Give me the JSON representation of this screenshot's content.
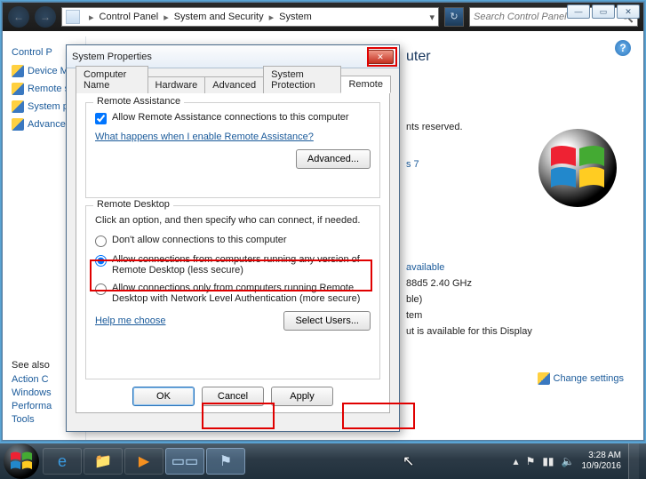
{
  "parent": {
    "breadcrumb": [
      "Control Panel",
      "System and Security",
      "System"
    ],
    "search_placeholder": "Search Control Panel",
    "sidebar": {
      "heading": "Control P",
      "items": [
        {
          "label": "Device M"
        },
        {
          "label": "Remote s"
        },
        {
          "label": "System p"
        },
        {
          "label": "Advance"
        }
      ],
      "see_also_heading": "See also",
      "see_also": [
        "Action C",
        "Windows",
        "Performa",
        "Tools"
      ]
    },
    "main": {
      "title_suffix": "uter",
      "rights": "nts reserved.",
      "edition_fragment": "s 7",
      "activation": "available",
      "processor": "88d5   2.40 GHz",
      "ram_suffix": "ble)",
      "system_type": "tem",
      "pen_touch": "ut is available for this Display",
      "change_settings": "Change settings"
    }
  },
  "dialog": {
    "title": "System Properties",
    "tabs": [
      "Computer Name",
      "Hardware",
      "Advanced",
      "System Protection",
      "Remote"
    ],
    "active_tab": "Remote",
    "remote_assistance": {
      "legend": "Remote Assistance",
      "checkbox_label": "Allow Remote Assistance connections to this computer",
      "checkbox_checked": true,
      "help_link": "What happens when I enable Remote Assistance?",
      "advanced_btn": "Advanced..."
    },
    "remote_desktop": {
      "legend": "Remote Desktop",
      "intro": "Click an option, and then specify who can connect, if needed.",
      "options": [
        "Don't allow connections to this computer",
        "Allow connections from computers running any version of Remote Desktop (less secure)",
        "Allow connections only from computers running Remote Desktop with Network Level Authentication (more secure)"
      ],
      "selected_index": 1,
      "help_link": "Help me choose",
      "select_users_btn": "Select Users..."
    },
    "buttons": {
      "ok": "OK",
      "cancel": "Cancel",
      "apply": "Apply"
    }
  },
  "taskbar": {
    "time": "3:28 AM",
    "date": "10/9/2016"
  }
}
